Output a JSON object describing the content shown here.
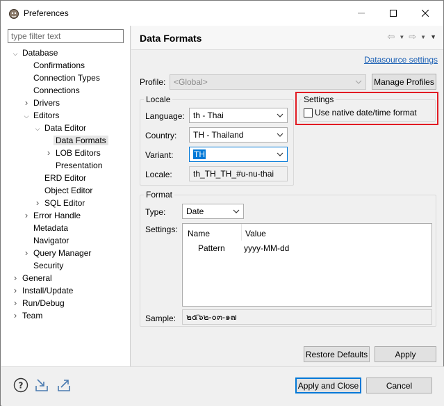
{
  "window": {
    "title": "Preferences"
  },
  "filter": {
    "placeholder": "type filter text"
  },
  "tree": [
    {
      "label": "Database",
      "twisty": "expanded"
    },
    {
      "label": "Confirmations",
      "twisty": ""
    },
    {
      "label": "Connection Types",
      "twisty": ""
    },
    {
      "label": "Connections",
      "twisty": ""
    },
    {
      "label": "Drivers",
      "twisty": "collapsed"
    },
    {
      "label": "Editors",
      "twisty": "expanded"
    },
    {
      "label": "Data Editor",
      "twisty": "expanded"
    },
    {
      "label": "Data Formats",
      "twisty": "",
      "selected": true
    },
    {
      "label": "LOB Editors",
      "twisty": "collapsed"
    },
    {
      "label": "Presentation",
      "twisty": ""
    },
    {
      "label": "ERD Editor",
      "twisty": ""
    },
    {
      "label": "Object Editor",
      "twisty": ""
    },
    {
      "label": "SQL Editor",
      "twisty": "collapsed"
    },
    {
      "label": "Error Handle",
      "twisty": "collapsed"
    },
    {
      "label": "Metadata",
      "twisty": ""
    },
    {
      "label": "Navigator",
      "twisty": ""
    },
    {
      "label": "Query Manager",
      "twisty": "collapsed"
    },
    {
      "label": "Security",
      "twisty": ""
    },
    {
      "label": "General",
      "twisty": "collapsed"
    },
    {
      "label": "Install/Update",
      "twisty": "collapsed"
    },
    {
      "label": "Run/Debug",
      "twisty": "collapsed"
    },
    {
      "label": "Team",
      "twisty": "collapsed"
    }
  ],
  "page": {
    "title": "Data Formats",
    "datasource_link": "Datasource settings",
    "profile_label": "Profile:",
    "profile_value": "<Global>",
    "manage_profiles": "Manage Profiles"
  },
  "locale": {
    "group_title": "Locale",
    "language_label": "Language:",
    "language_value": "th - Thai",
    "country_label": "Country:",
    "country_value": "TH - Thailand",
    "variant_label": "Variant:",
    "variant_value": "TH",
    "locale_label": "Locale:",
    "locale_value": "th_TH_TH_#u-nu-thai"
  },
  "settings": {
    "group_title": "Settings",
    "native_label": "Use native date/time format",
    "native_checked": false
  },
  "format": {
    "group_title": "Format",
    "type_label": "Type:",
    "type_value": "Date",
    "settings_label": "Settings:",
    "columns": [
      "Name",
      "Value"
    ],
    "rows": [
      {
        "name": "Pattern",
        "value": "yyyy-MM-dd"
      }
    ],
    "sample_label": "Sample:",
    "sample_value": "๒๕๖๒-๐๓-๑๗"
  },
  "buttons": {
    "restore_defaults": "Restore Defaults",
    "apply": "Apply",
    "apply_close": "Apply and Close",
    "cancel": "Cancel"
  },
  "colors": {
    "highlight_box": "#e21b23",
    "link": "#1a5fb4",
    "selection": "#0078d7"
  }
}
